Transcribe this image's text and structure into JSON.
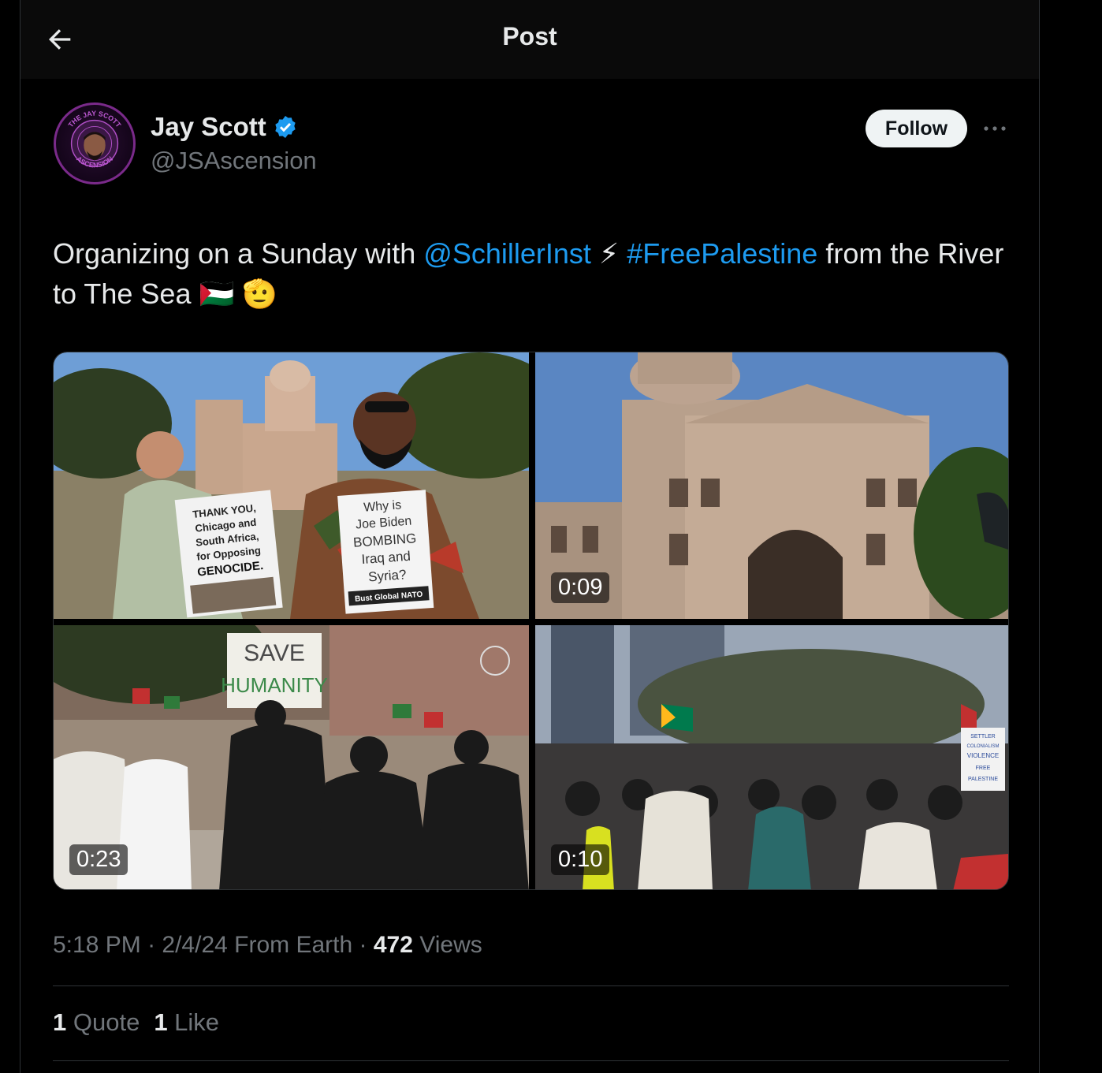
{
  "header": {
    "title": "Post",
    "back_icon": "arrow-left-icon"
  },
  "author": {
    "name": "Jay Scott",
    "handle": "@JSAscension",
    "verified": true,
    "badge_color": "#1d9bf0",
    "avatar_text_top": "THE JAY SCOTT",
    "avatar_text_bottom": "ASCENSION"
  },
  "actions": {
    "follow_label": "Follow",
    "more_icon": "more-icon"
  },
  "post": {
    "text_1": "Organizing on a Sunday with ",
    "mention": "@SchillerInst",
    "text_2": " ⚡ ",
    "hashtag": "#FreePalestine",
    "text_3": " from the River to The Sea ",
    "emoji": "🇵🇸 🫡",
    "accent_color": "#1d9bf0"
  },
  "media": [
    {
      "kind": "photo",
      "description": "photo",
      "sign_left": [
        "THANK YOU,",
        "Chicago and",
        "South Africa,",
        "for Opposing",
        "GENOCIDE."
      ],
      "sign_right": [
        "Why is",
        "Joe Biden",
        "BOMBING",
        "Iraq and",
        "Syria?",
        "Bust Global NATO"
      ]
    },
    {
      "kind": "video",
      "duration": "0:09"
    },
    {
      "kind": "video",
      "duration": "0:23",
      "sign": [
        "SAVE",
        "HUMANITY"
      ]
    },
    {
      "kind": "video",
      "duration": "0:10",
      "sign": [
        "SETTLER",
        "COLONIALISM",
        "VIOLENCE",
        "FREE",
        "PALESTINE"
      ]
    }
  ],
  "meta": {
    "time": "5:18 PM",
    "sep": " · ",
    "date": "2/4/24",
    "source": " From Earth",
    "views_count": "472",
    "views_label": " Views"
  },
  "stats": {
    "quotes_count": "1",
    "quotes_label": " Quote",
    "likes_count": "1",
    "likes_label": " Like"
  }
}
